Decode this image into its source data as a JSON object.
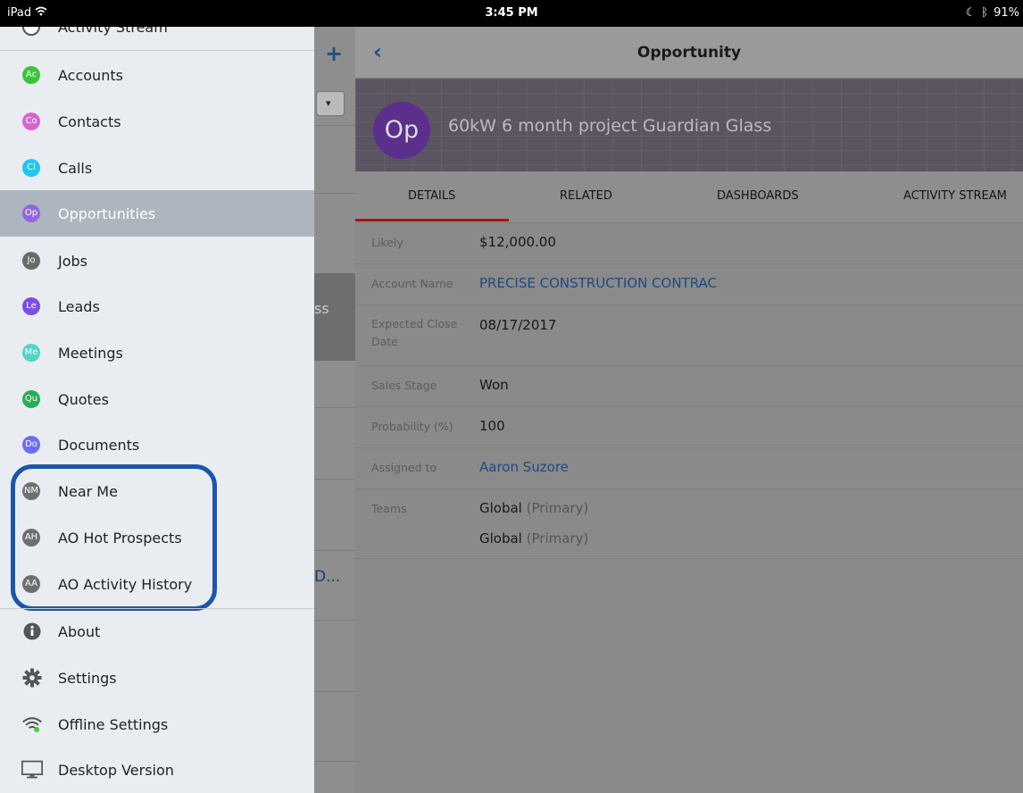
{
  "status_bar": {
    "device": "iPad",
    "wifi_icon": "wifi-icon",
    "time": "3:45 PM",
    "battery": "91%"
  },
  "sidebar": {
    "partial_item": "Activity Stream",
    "items": [
      {
        "badge": "Ac",
        "label": "Accounts",
        "color": "#3cc43c"
      },
      {
        "badge": "Co",
        "label": "Contacts",
        "color": "#d765d0"
      },
      {
        "badge": "Cl",
        "label": "Calls",
        "color": "#1ec6f0"
      },
      {
        "badge": "Op",
        "label": "Opportunities",
        "color": "#9265de",
        "active": true
      },
      {
        "badge": "Jo",
        "label": "Jobs",
        "color": "#6a6a6a"
      },
      {
        "badge": "Le",
        "label": "Leads",
        "color": "#7b4fe6"
      },
      {
        "badge": "Me",
        "label": "Meetings",
        "color": "#50d6c6"
      },
      {
        "badge": "Qu",
        "label": "Quotes",
        "color": "#2cad53"
      },
      {
        "badge": "Do",
        "label": "Documents",
        "color": "#6b6ef0"
      },
      {
        "badge": "NM",
        "label": "Near Me",
        "color": "#6f6f6f"
      },
      {
        "badge": "AH",
        "label": "AO Hot Prospects",
        "color": "#6f6f6f"
      },
      {
        "badge": "AA",
        "label": "AO Activity History",
        "color": "#6f6f6f"
      }
    ],
    "footer_items": [
      {
        "icon": "info-icon",
        "label": "About"
      },
      {
        "icon": "gear-icon",
        "label": "Settings"
      },
      {
        "icon": "wifi-icon",
        "label": "Offline Settings"
      },
      {
        "icon": "monitor-icon",
        "label": "Desktop Version"
      }
    ]
  },
  "middle": {
    "add_icon": "plus-icon",
    "truncated_text_1": "ss",
    "truncated_text_2": "D..."
  },
  "detail": {
    "back_icon": "chevron-left-icon",
    "title": "Opportunity",
    "avatar": "Op",
    "record_name": "60kW 6 month project Guardian Glass",
    "tabs": [
      "DETAILS",
      "RELATED",
      "DASHBOARDS",
      "ACTIVITY STREAM"
    ],
    "active_tab": "DETAILS",
    "fields": {
      "likely_label": "Likely",
      "likely_value": "$12,000.00",
      "account_label": "Account Name",
      "account_value": "PRECISE CONSTRUCTION CONTRAC",
      "close_label": "Expected Close Date",
      "close_value": "08/17/2017",
      "stage_label": "Sales Stage",
      "stage_value": "Won",
      "prob_label": "Probability (%)",
      "prob_value": "100",
      "assigned_label": "Assigned to",
      "assigned_value": "Aaron Suzore",
      "teams_label": "Teams",
      "team1_name": "Global",
      "team1_role": "(Primary)",
      "team2_name": "Global",
      "team2_role": "(Primary)"
    }
  },
  "colors": {
    "accent": "#1b56ab",
    "tab_indicator": "#a31516",
    "link": "#1b4c84"
  }
}
